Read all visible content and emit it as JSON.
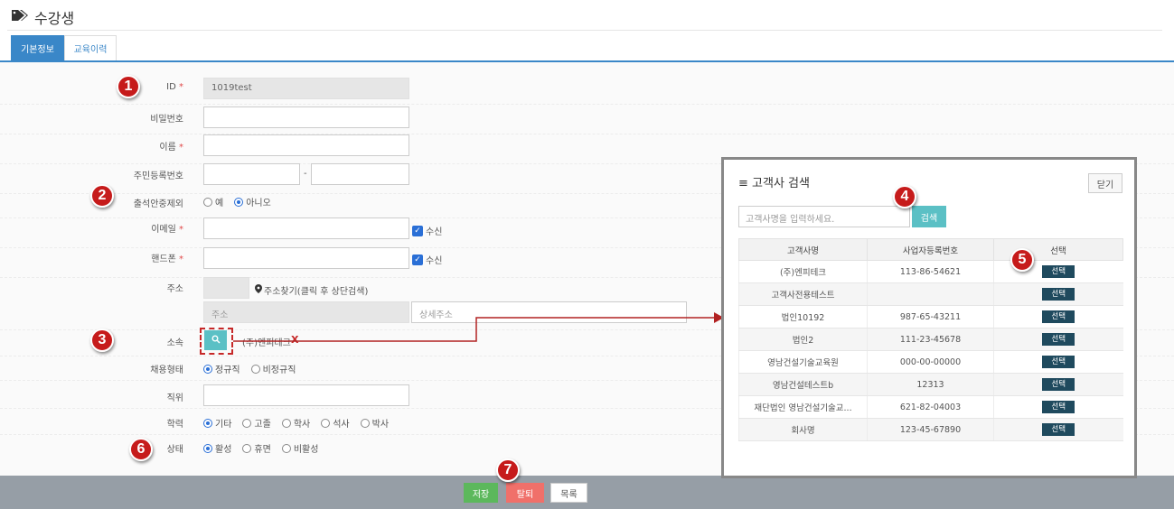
{
  "page": {
    "title": "수강생"
  },
  "tabs": [
    {
      "label": "기본정보",
      "active": true
    },
    {
      "label": "교육이력",
      "active": false
    }
  ],
  "form": {
    "id": {
      "label": "ID",
      "value": "1019test"
    },
    "password": {
      "label": "비밀번호"
    },
    "name": {
      "label": "이름"
    },
    "rrn": {
      "label": "주민등록번호",
      "sep": "-"
    },
    "attendance": {
      "label": "출석안중제외",
      "options": [
        "예",
        "아니오"
      ],
      "selected": "아니오"
    },
    "email": {
      "label": "이메일",
      "receive": "수신"
    },
    "phone": {
      "label": "핸드폰",
      "receive": "수신"
    },
    "address": {
      "label": "주소",
      "find_link": "주소찾기(클릭 후 상단검색)",
      "addr_placeholder": "주소",
      "detail_placeholder": "상세주소"
    },
    "affiliation": {
      "label": "소속",
      "value": "(주)엔피테크",
      "remove": "X"
    },
    "employment": {
      "label": "채용형태",
      "options": [
        "정규직",
        "비정규직"
      ],
      "selected": "정규직"
    },
    "position": {
      "label": "직위"
    },
    "education": {
      "label": "학력",
      "options": [
        "기타",
        "고졸",
        "학사",
        "석사",
        "박사"
      ],
      "selected": "기타"
    },
    "status": {
      "label": "상태",
      "options": [
        "활성",
        "휴면",
        "비활성"
      ],
      "selected": "활성"
    }
  },
  "footer": {
    "save": "저장",
    "withdraw": "탈퇴",
    "list": "목록"
  },
  "modal": {
    "title": "고객사 검색",
    "close": "닫기",
    "search_placeholder": "고객사명을 입력하세요.",
    "search_btn": "검색",
    "columns": [
      "고객사명",
      "사업자등록번호",
      "선택"
    ],
    "select_label": "선택",
    "rows": [
      {
        "name": "(주)엔피테크",
        "biz": "113-86-54621"
      },
      {
        "name": "고객사전용테스트",
        "biz": ""
      },
      {
        "name": "법인10192",
        "biz": "987-65-43211"
      },
      {
        "name": "법인2",
        "biz": "111-23-45678"
      },
      {
        "name": "영남건설기술교육원",
        "biz": "000-00-00000"
      },
      {
        "name": "영남건설테스트b",
        "biz": "12313"
      },
      {
        "name": "재단법인 영남건설기술교...",
        "biz": "621-82-04003"
      },
      {
        "name": "회사명",
        "biz": "123-45-67890"
      }
    ]
  },
  "badges": [
    "1",
    "2",
    "3",
    "4",
    "5",
    "6",
    "7"
  ],
  "colors": {
    "accent": "#3a87c8",
    "badge": "#c61b1b",
    "save": "#5cb85c",
    "withdraw": "#f0706a",
    "arrow": "#b22222",
    "search": "#5bc0c5"
  }
}
